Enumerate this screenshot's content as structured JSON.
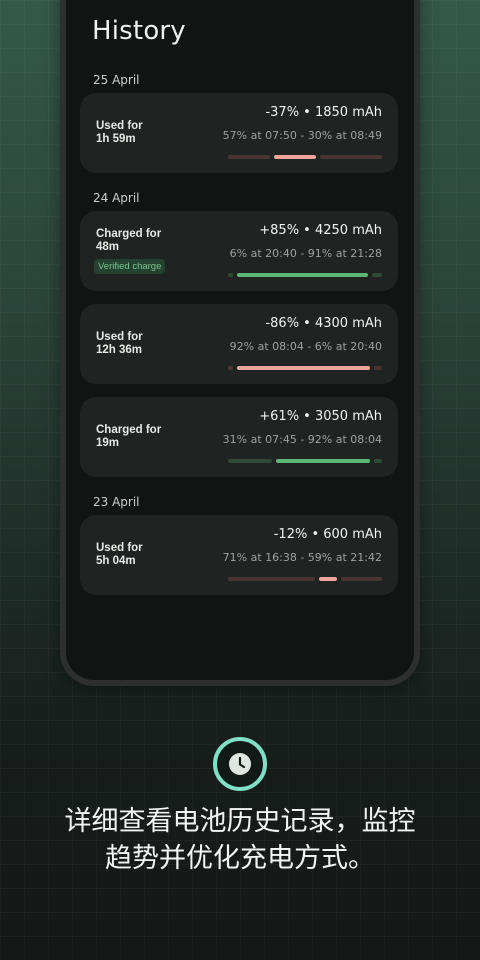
{
  "history": {
    "title": "History",
    "groups": [
      {
        "date": "25 April",
        "entries": [
          {
            "label_line1": "Used for",
            "label_line2": "1h 59m",
            "badge": "",
            "summary": "-37% • 1850 mAh",
            "range": "57% at 07:50 - 30% at 08:49",
            "type": "discharge",
            "start_pct": 57,
            "end_pct": 30
          }
        ]
      },
      {
        "date": "24 April",
        "entries": [
          {
            "label_line1": "Charged for",
            "label_line2": "48m",
            "badge": "Verified charge",
            "summary": "+85% • 4250 mAh",
            "range": "6% at 20:40 - 91% at 21:28",
            "type": "charge",
            "start_pct": 6,
            "end_pct": 91
          },
          {
            "label_line1": "Used for",
            "label_line2": "12h 36m",
            "badge": "",
            "summary": "-86% • 4300 mAh",
            "range": "92% at 08:04 - 6% at 20:40",
            "type": "discharge",
            "start_pct": 92,
            "end_pct": 6
          },
          {
            "label_line1": "Charged for",
            "label_line2": "19m",
            "badge": "",
            "summary": "+61% • 3050 mAh",
            "range": "31% at 07:45 - 92% at 08:04",
            "type": "charge",
            "start_pct": 31,
            "end_pct": 92
          }
        ]
      },
      {
        "date": "23 April",
        "entries": [
          {
            "label_line1": "Used for",
            "label_line2": "5h 04m",
            "badge": "",
            "summary": "-12% • 600 mAh",
            "range": "71% at 16:38 - 59% at 21:42",
            "type": "discharge",
            "start_pct": 71,
            "end_pct": 59
          }
        ]
      }
    ]
  },
  "promo": {
    "icon": "clock-icon",
    "line1": "详细查看电池历史记录，监控",
    "line2": "趋势并优化充电方式。"
  },
  "colors": {
    "accent_ring": "#7fe0c4",
    "charge": "#5db673",
    "charge_track": "#2f4a37",
    "discharge": "#f2a39a",
    "discharge_track": "#4a3533"
  }
}
